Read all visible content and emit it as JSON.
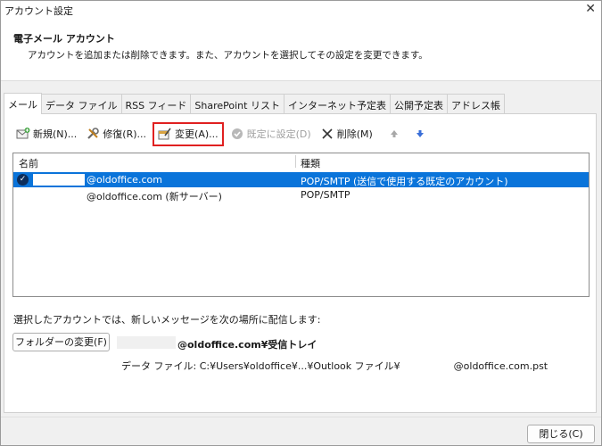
{
  "window": {
    "title": "アカウント設定",
    "close_glyph": "✕"
  },
  "header": {
    "title": "電子メール アカウント",
    "description": "アカウントを追加または削除できます。また、アカウントを選択してその設定を変更できます。"
  },
  "tabs": [
    {
      "label": "メール",
      "active": true
    },
    {
      "label": "データ ファイル",
      "active": false
    },
    {
      "label": "RSS フィード",
      "active": false
    },
    {
      "label": "SharePoint リスト",
      "active": false
    },
    {
      "label": "インターネット予定表",
      "active": false
    },
    {
      "label": "公開予定表",
      "active": false
    },
    {
      "label": "アドレス帳",
      "active": false
    }
  ],
  "toolbar": {
    "new_label": "新規(N)...",
    "repair_label": "修復(R)...",
    "change_label": "変更(A)...",
    "set_default_label": "既定に設定(D)",
    "remove_label": "削除(M)",
    "icons": {
      "new": "new-mail-icon",
      "repair": "repair-tools-icon",
      "change": "change-settings-icon",
      "set_default": "check-circle-icon",
      "remove": "x-icon",
      "up": "arrow-up-icon",
      "down": "arrow-down-icon"
    },
    "highlight_color": "#e02020"
  },
  "accounts": {
    "columns": {
      "name": "名前",
      "type": "種類"
    },
    "rows": [
      {
        "name": "@oldoffice.com",
        "type": "POP/SMTP (送信で使用する既定のアカウント)",
        "selected": true,
        "default": true
      },
      {
        "name": "@oldoffice.com (新サーバー)",
        "type": "POP/SMTP",
        "selected": false,
        "default": false
      }
    ],
    "selection_color": "#0a74da"
  },
  "delivery": {
    "label": "選択したアカウントでは、新しいメッセージを次の場所に配信します:",
    "change_folder_label": "フォルダーの変更(F)",
    "folder_path": "@oldoffice.com¥受信トレイ",
    "datafile_prefix": "データ ファイル: C:¥Users¥oldoffice¥...¥Outlook ファイル¥",
    "datafile_suffix": "@oldoffice.com.pst"
  },
  "footer": {
    "close_label": "閉じる(C)"
  }
}
